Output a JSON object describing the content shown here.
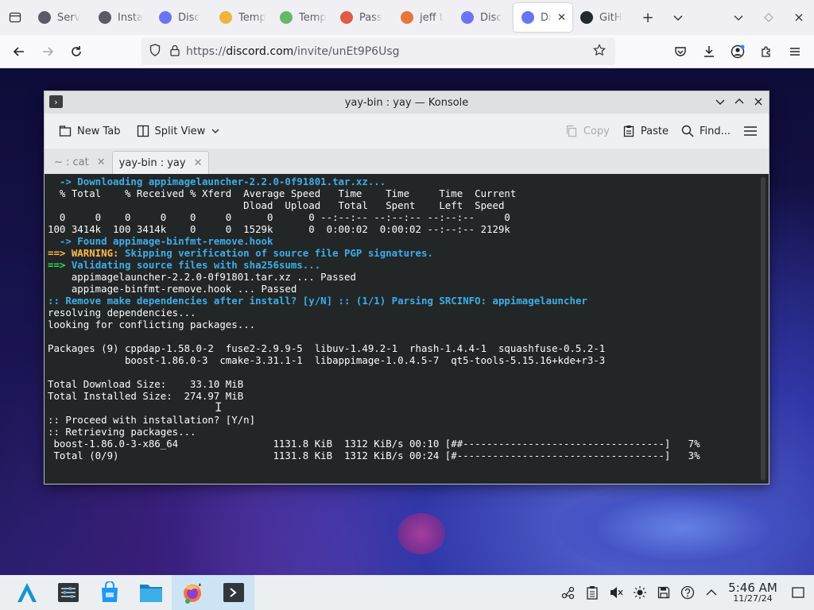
{
  "browser": {
    "tabs": [
      {
        "label": "Serv",
        "icon": "game-controller-icon",
        "color": "#5b5b66"
      },
      {
        "label": "Insta",
        "icon": "game-controller-icon",
        "color": "#5b5b66"
      },
      {
        "label": "Disc",
        "icon": "discord-icon",
        "color": "#6c74f4"
      },
      {
        "label": "Temp",
        "icon": "mail-icon",
        "color": "#f0b43c"
      },
      {
        "label": "Temp",
        "icon": "mail-icon",
        "color": "#69b86a"
      },
      {
        "label": "Pass",
        "icon": "rabbit-icon",
        "color": "#e05b47"
      },
      {
        "label": "jeff t",
        "icon": "jeff-icon",
        "color": "#e8763a"
      },
      {
        "label": "Disc",
        "icon": "discord-icon",
        "color": "#6c74f4"
      },
      {
        "label": "Di",
        "icon": "discord-icon",
        "color": "#6c74f4"
      },
      {
        "label": "GitH",
        "icon": "github-icon",
        "color": "#24292e"
      }
    ],
    "url": {
      "prefix": "https://",
      "domain": "discord.com",
      "path": "/invite/unEt9P6Usg"
    }
  },
  "konsole": {
    "title": "yay-bin : yay — Konsole",
    "toolbar": {
      "new_tab": "New Tab",
      "split_view": "Split View",
      "copy": "Copy",
      "paste": "Paste",
      "find": "Find..."
    },
    "tabs": [
      {
        "label": "~ : cat"
      },
      {
        "label": "yay-bin : yay"
      }
    ],
    "lines": [
      [
        {
          "t": "  -> Downloading appimagelauncher-2.2.0-0f91801.tar.xz...",
          "c": "blue"
        }
      ],
      [
        {
          "t": "  % Total    % Received % Xferd  Average Speed   Time    Time     Time  Current"
        }
      ],
      [
        {
          "t": "                                 Dload  Upload   Total   Spent    Left  Speed"
        }
      ],
      [
        {
          "t": "  0     0    0     0    0     0      0      0 --:--:-- --:--:-- --:--:--     0"
        }
      ],
      [
        {
          "t": "100 3414k  100 3414k    0     0  1529k      0  0:00:02  0:00:02 --:--:-- 2129k"
        }
      ],
      [
        {
          "t": "  -> Found appimage-binfmt-remove.hook",
          "c": "blue"
        }
      ],
      [
        {
          "t": "==> ",
          "c": "yellow"
        },
        {
          "t": "WARNING:",
          "c": "yellow"
        },
        {
          "t": " Skipping verification of source file PGP signatures.",
          "c": "blue"
        }
      ],
      [
        {
          "t": "==>",
          "c": "green"
        },
        {
          "t": " Validating source files with sha256sums...",
          "c": "blue"
        }
      ],
      [
        {
          "t": "    appimagelauncher-2.2.0-0f91801.tar.xz ... Passed"
        }
      ],
      [
        {
          "t": "    appimage-binfmt-remove.hook ... Passed"
        }
      ],
      [
        {
          "t": "::",
          "c": "blue"
        },
        {
          "t": " Remove make dependencies after install? [y/N] ",
          "c": "blue"
        },
        {
          "t": "::",
          "c": "blue"
        },
        {
          "t": " (1/1) Parsing SRCINFO: appimagelauncher",
          "c": "blue"
        }
      ],
      [
        {
          "t": "resolving dependencies..."
        }
      ],
      [
        {
          "t": "looking for conflicting packages..."
        }
      ],
      [
        {
          "t": ""
        }
      ],
      [
        {
          "t": "Packages (9) cppdap-1.58.0-2  fuse2-2.9.9-5  libuv-1.49.2-1  rhash-1.4.4-1  squashfuse-0.5.2-1"
        }
      ],
      [
        {
          "t": "             boost-1.86.0-3  cmake-3.31.1-1  libappimage-1.0.4.5-7  qt5-tools-5.15.16+kde+r3-3"
        }
      ],
      [
        {
          "t": ""
        }
      ],
      [
        {
          "t": "Total Download Size:    33.10 MiB"
        }
      ],
      [
        {
          "t": "Total Installed Size:  274.97 MiB"
        }
      ],
      [
        {
          "t": ""
        }
      ],
      [
        {
          "t": ":: Proceed with installation? [Y/n]"
        }
      ],
      [
        {
          "t": ":: Retrieving packages..."
        }
      ],
      [
        {
          "t": " boost-1.86.0-3-x86_64                1131.8 KiB  1312 KiB/s 00:10 [##----------------------------------]   7%"
        }
      ],
      [
        {
          "t": " Total (0/9)                          1131.8 KiB  1312 KiB/s 00:24 [#-----------------------------------]   3%"
        }
      ]
    ]
  },
  "taskbar": {
    "apps": [
      "app-launcher-icon",
      "settings-icon",
      "store-icon",
      "files-icon",
      "firefox-icon",
      "konsole-icon"
    ],
    "clock": {
      "time": "5:46 AM",
      "date": "11/27/24"
    }
  }
}
